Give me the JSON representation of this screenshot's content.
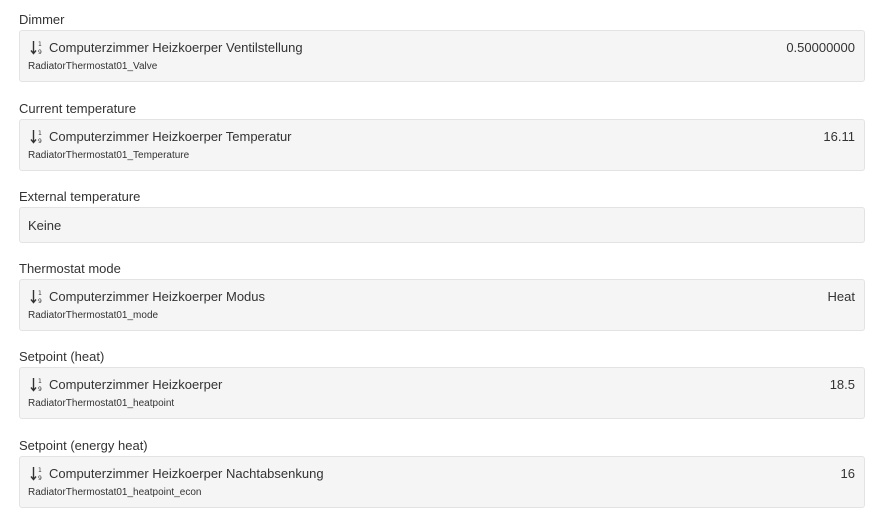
{
  "icons": {
    "numeric_sort": "sort-numeric-icon"
  },
  "sections": [
    {
      "label": "Dimmer",
      "title": "Computerzimmer Heizkoerper Ventilstellung",
      "item_name": "RadiatorThermostat01_Valve",
      "value": "0.50000000"
    },
    {
      "label": "Current temperature",
      "title": "Computerzimmer Heizkoerper Temperatur",
      "item_name": "RadiatorThermostat01_Temperature",
      "value": "16.11"
    },
    {
      "label": "External temperature",
      "none_text": "Keine"
    },
    {
      "label": "Thermostat mode",
      "title": "Computerzimmer Heizkoerper Modus",
      "item_name": "RadiatorThermostat01_mode",
      "value": "Heat"
    },
    {
      "label": "Setpoint (heat)",
      "title": "Computerzimmer Heizkoerper",
      "item_name": "RadiatorThermostat01_heatpoint",
      "value": "18.5"
    },
    {
      "label": "Setpoint (energy heat)",
      "title": "Computerzimmer Heizkoerper Nachtabsenkung",
      "item_name": "RadiatorThermostat01_heatpoint_econ",
      "value": "16"
    }
  ]
}
